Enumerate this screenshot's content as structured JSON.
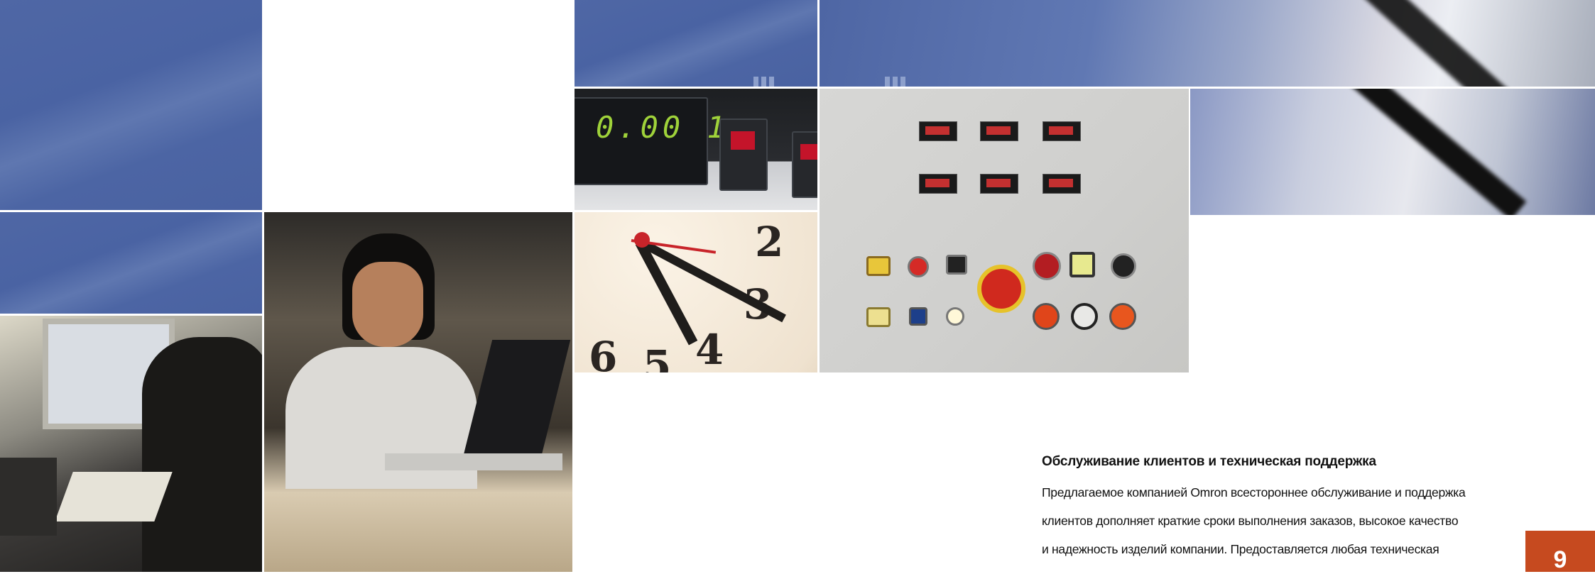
{
  "section": {
    "heading": "Обслуживание клиентов и техническая поддержка",
    "lines": [
      "Предлагаемое компанией Omron всестороннее обслуживание и поддержка",
      "клиентов дополняет краткие сроки выполнения заказов, высокое качество",
      "и надежность изделий компании. Предоставляется любая техническая"
    ]
  },
  "page_number": "9",
  "colors": {
    "tile_blue": "#4a63a3",
    "page_number_bg": "#c64a1f"
  },
  "photos": {
    "meters_display": "0.00 1"
  }
}
